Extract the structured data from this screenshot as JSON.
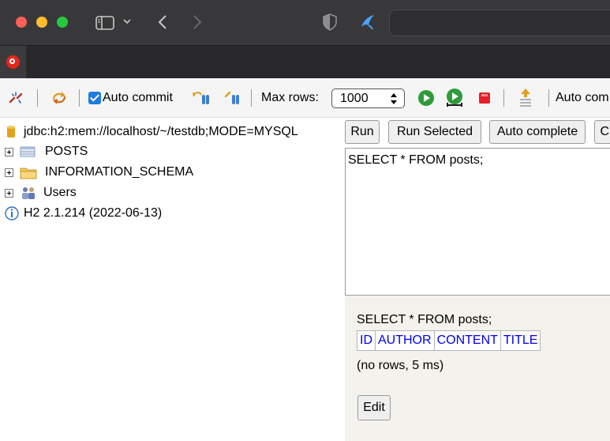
{
  "browser": {
    "url_value": ""
  },
  "toolbar": {
    "auto_commit_label": "Auto commit",
    "max_rows_label": "Max rows:",
    "max_rows_value": "1000",
    "auto_complete_label": "Auto com"
  },
  "tree": {
    "connection": "jdbc:h2:mem://localhost/~/testdb;MODE=MYSQL",
    "items": [
      {
        "label": "POSTS"
      },
      {
        "label": "INFORMATION_SCHEMA"
      },
      {
        "label": "Users"
      }
    ],
    "version": "H2 2.1.214 (2022-06-13)"
  },
  "editor": {
    "buttons": {
      "run": "Run",
      "run_selected": "Run Selected",
      "auto_complete": "Auto complete",
      "clear": "Cl"
    },
    "sql": "SELECT * FROM posts;"
  },
  "results": {
    "statement": "SELECT * FROM posts;",
    "columns": [
      "ID",
      "AUTHOR",
      "CONTENT",
      "TITLE"
    ],
    "status": "(no rows, 5 ms)",
    "edit_label": "Edit"
  },
  "colors": {
    "titlebar": "#38383a",
    "link_blue": "#0000ee",
    "results_bg": "#f4f2ec",
    "checkbox_blue": "#1f7ae0"
  }
}
